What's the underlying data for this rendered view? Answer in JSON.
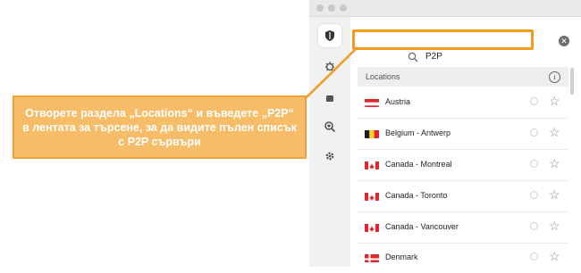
{
  "search": {
    "query": "P2P"
  },
  "locations": {
    "header": "Locations",
    "items": [
      {
        "name": "Austria",
        "flag": "austria"
      },
      {
        "name": "Belgium - Antwerp",
        "flag": "belgium"
      },
      {
        "name": "Canada - Montreal",
        "flag": "canada"
      },
      {
        "name": "Canada - Toronto",
        "flag": "canada"
      },
      {
        "name": "Canada - Vancouver",
        "flag": "canada"
      },
      {
        "name": "Denmark",
        "flag": "denmark"
      }
    ]
  },
  "sidebar": {
    "icons": [
      "shield-icon",
      "virus-icon",
      "lock-icon",
      "search-icon",
      "gear-icon"
    ]
  },
  "callout": {
    "text": "Отворете раздела „Locations“ и въведете „P2P“ в лентата за търсене, за да видите пълен списък с P2P сървъри"
  },
  "colors": {
    "highlight": "#f29b1d",
    "callout_bg": "#f7bc68"
  }
}
